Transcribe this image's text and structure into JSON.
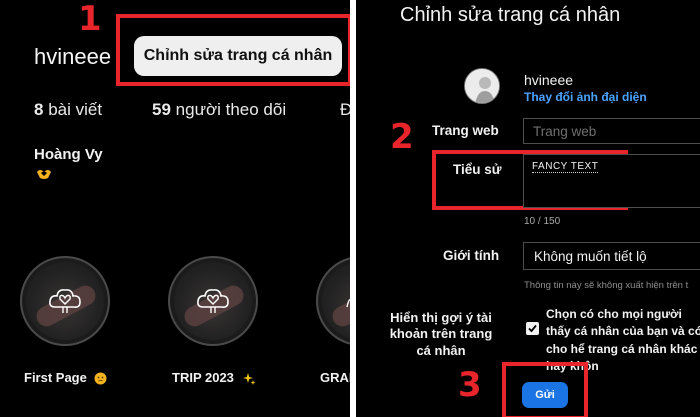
{
  "steps": {
    "one": "1",
    "two": "2",
    "three": "3"
  },
  "profile": {
    "username": "hvineee",
    "edit_button": "Chỉnh sửa trang cá nhân",
    "posts_count": "8",
    "posts_label": "bài viết",
    "followers_count": "59",
    "followers_label": "người theo dõi",
    "following_partial": "Đa",
    "full_name": "Hoàng Vy"
  },
  "highlights": [
    {
      "label": "First Page",
      "emoji": "face-emoji"
    },
    {
      "label": "TRIP 2023",
      "emoji": "sparkles-emoji"
    },
    {
      "label": "GRADU",
      "emoji": ""
    }
  ],
  "edit_form": {
    "title": "Chỉnh sửa trang cá nhân",
    "username": "hvineee",
    "change_avatar": "Thay đổi ảnh đại diện",
    "website_label": "Trang web",
    "website_placeholder": "Trang web",
    "bio_label": "Tiểu sử",
    "bio_value": "FANCY TEXT",
    "bio_count": "10 / 150",
    "gender_label": "Giới tính",
    "gender_value": "Không muốn tiết lộ",
    "gender_note": "Thông tin này sẽ không xuất hiện trên t",
    "suggest_label": "Hiển thị gợi ý tài khoản trên trang cá nhân",
    "suggest_text": "Chọn có cho mọi người thấy cá nhân của bạn và có cho hể trang cá nhân khác hay khôn",
    "suggest_checked": true,
    "submit_label": "Gửi"
  },
  "colors": {
    "accent_red": "#e8252b",
    "link_blue": "#4aa3ff",
    "button_blue": "#1b74e4",
    "background": "#000000"
  }
}
